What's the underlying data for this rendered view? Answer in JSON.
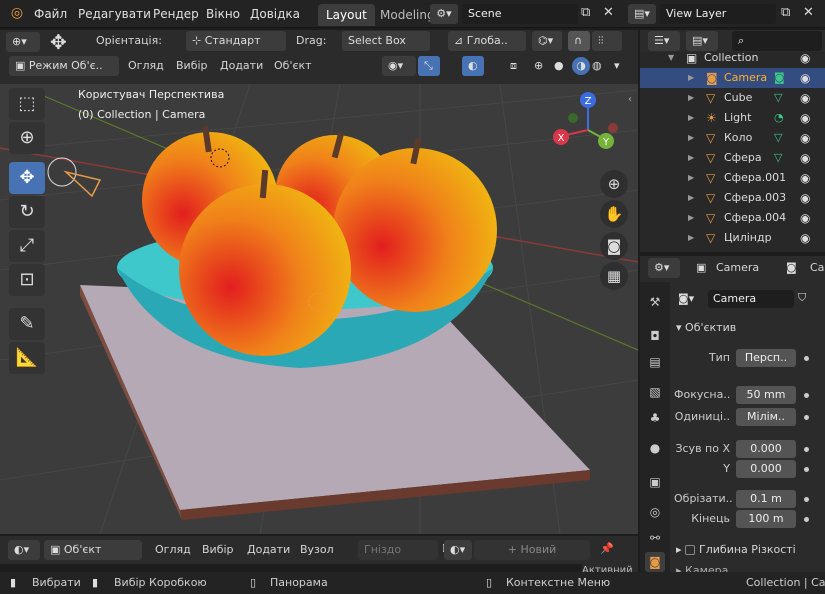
{
  "topbar": {
    "menus": [
      "Файл",
      "Редагувати",
      "Рендер",
      "Вікно",
      "Довідка"
    ],
    "workspaces": [
      "Layout",
      "Modeling"
    ],
    "active_workspace": "Layout",
    "scene_name": "Scene",
    "view_layer": "View Layer"
  },
  "viewport_header": {
    "orientation_label": "Орієнтація:",
    "orientation_value": "Стандарт",
    "drag_label": "Drag:",
    "drag_value": "Select Box",
    "pivot_value": "Глоба..",
    "mode": "Режим Об'є..",
    "menus": [
      "Огляд",
      "Вибір",
      "Додати",
      "Об'єкт"
    ]
  },
  "viewport": {
    "view_name": "Користувач Перспектива",
    "context": "(0) Collection | Camera",
    "gizmo_axes": [
      "Z",
      "Y",
      "X"
    ]
  },
  "outliner": {
    "collection": "Collection",
    "items": [
      {
        "name": "Camera",
        "selected": true
      },
      {
        "name": "Cube",
        "selected": false
      },
      {
        "name": "Light",
        "selected": false
      },
      {
        "name": "Коло",
        "selected": false
      },
      {
        "name": "Сфера",
        "selected": false
      },
      {
        "name": "Сфера.001",
        "selected": false
      },
      {
        "name": "Сфера.003",
        "selected": false
      },
      {
        "name": "Сфера.004",
        "selected": false
      },
      {
        "name": "Циліндр",
        "selected": false
      }
    ]
  },
  "properties": {
    "header_object": "Camera",
    "header_data": "Ca",
    "data_name": "Camera",
    "lens_panel": "Об'єктив",
    "type_label": "Тип",
    "type_value": "Персп..",
    "focal_label": "Фокусна..",
    "focal_value": "50 mm",
    "units_label": "Одиниці..",
    "units_value": "Мілім..",
    "shift_x_label": "Зсув по X",
    "shift_x_value": "0.000",
    "shift_y_label": "Y",
    "shift_y_value": "0.000",
    "clip_start_label": "Обрізати..",
    "clip_start_value": "0.1 m",
    "clip_end_label": "Кінець",
    "clip_end_value": "100 m",
    "dof_panel": "Глибина Різкості",
    "camera_panel": "Камера"
  },
  "timeline": {
    "mode": "Об'єкт",
    "menus": [
      "Огляд",
      "Вибір",
      "Додати",
      "Вузол"
    ],
    "slot": "Гніздо",
    "new_button": "Новий",
    "active_tool": "Активний"
  },
  "status": {
    "select": "Вибрати",
    "box_select": "Вибір Коробкою",
    "pan": "Панорама",
    "context_menu": "Контекстне Меню",
    "path": "Collection | Cam"
  },
  "colors": {
    "accent": "#4772b3",
    "object_orange": "#e69b49",
    "selected_row": "#334d80"
  }
}
